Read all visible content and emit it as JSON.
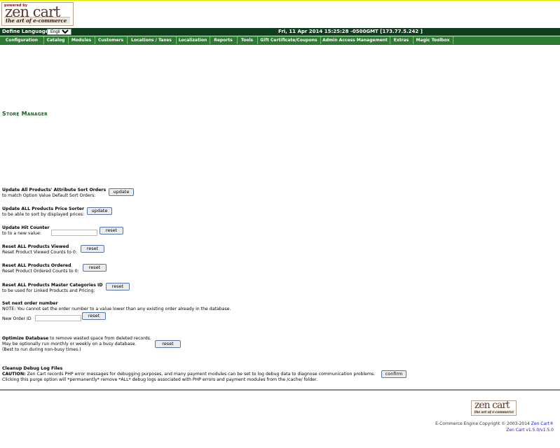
{
  "header": {
    "logo_powered_by": "powered by",
    "logo_text": "zen cart",
    "logo_tagline": "the art of e-commerce",
    "define_language_label": "Define Language:",
    "language_selected": "English",
    "datetime": "Fri, 11 Apr 2014 15:25:28 -0500GMT [173.77.5.242 ]"
  },
  "menu": {
    "items": [
      {
        "label": "Configuration"
      },
      {
        "label": "Catalog"
      },
      {
        "label": "Modules"
      },
      {
        "label": "Customers"
      },
      {
        "label": "Locations / Taxes"
      },
      {
        "label": "Localization"
      },
      {
        "label": "Reports"
      },
      {
        "label": "Tools"
      },
      {
        "label": "Gift Certificate/Coupons"
      },
      {
        "label": "Admin Access Management"
      },
      {
        "label": "Extras"
      },
      {
        "label": "Magic Toolbox"
      }
    ]
  },
  "main": {
    "page_title": "Store Manager",
    "sections": {
      "sort_orders": {
        "title": "Update All Products' Attribute Sort Orders",
        "desc": "to match Option Value Default Sort Orders:",
        "button": "update"
      },
      "price_sorter": {
        "title": "Update ALL Products Price Sorter",
        "desc": "to be able to sort by displayed prices:",
        "button": "update"
      },
      "hit_counter": {
        "title": "Update Hit Counter",
        "desc": "to to a new value:",
        "input_value": "",
        "button": "reset"
      },
      "products_viewed": {
        "title": "Reset ALL Products Viewed",
        "desc": "Reset Product Viewed Counts to 0:",
        "button": "reset"
      },
      "products_ordered": {
        "title": "Reset ALL Products Ordered",
        "desc": "Reset Product Ordered Counts to 0:",
        "button": "reset"
      },
      "master_categories": {
        "title": "Reset ALL Products Master Categories ID",
        "desc": "to be used for Linked Products and Pricing:",
        "button": "reset"
      },
      "next_order": {
        "title": "Set next order number",
        "note": "NOTE: You cannot set the order number to a value lower than any existing order already in the database.",
        "input_label": "New Order ID",
        "input_value": "",
        "button": "reset"
      },
      "optimize": {
        "title": "Optimize Database",
        "title_rest": " to remove wasted space from deleted records.",
        "line2": "May be optionally run monthly or weekly on a busy database.",
        "line3": "(Best to run during non-busy times.)",
        "button": "reset"
      },
      "debug_logs": {
        "title": "Cleanup Debug Log Files",
        "caution_label": "CAUTION:",
        "caution_text": " Zen Cart records PHP error messages for debugging purposes, and many payment modules can be set to log debug data to diagnose communication problems.",
        "line2": "Clicking this purge option will *permanently* remove *ALL* debug logs associated with PHP errors and payment modules from the /cache/ folder.",
        "button": "confirm"
      }
    }
  },
  "footer": {
    "logo_text": "zen cart",
    "logo_tagline": "the art of e-commerce",
    "copyright": "E-Commerce Engine Copyright © 2003-2014 ",
    "link_text": "Zen Cart®",
    "version": "Zen Cart v1.5.0/v1.5.0"
  }
}
